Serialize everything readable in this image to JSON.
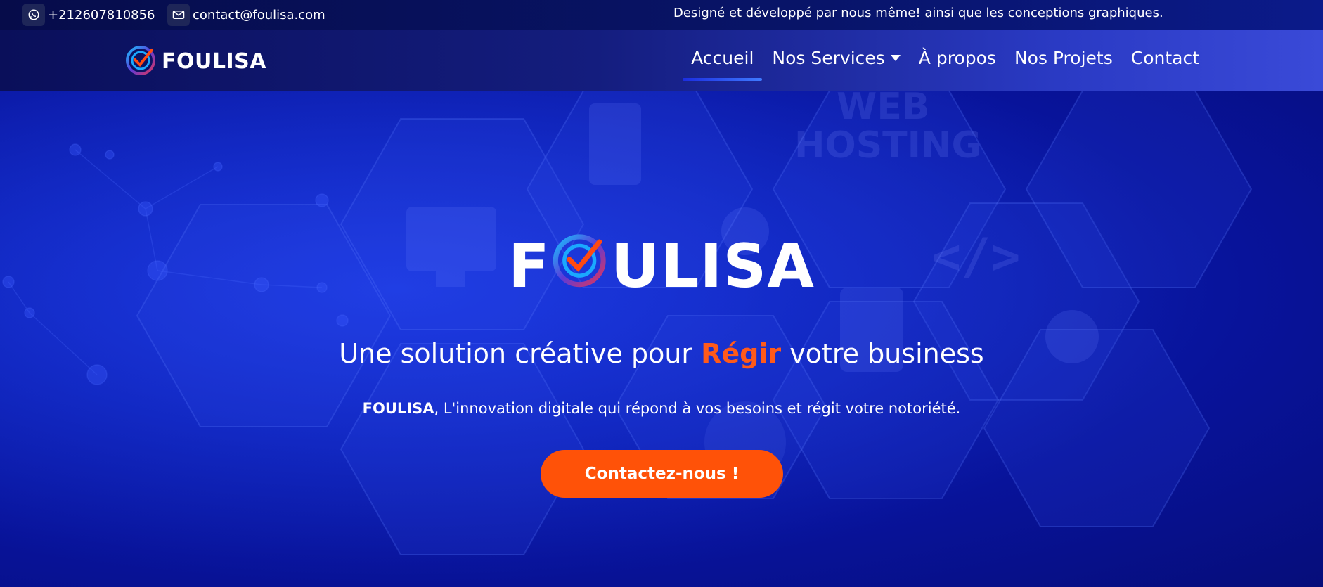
{
  "topbar": {
    "phone": "+212607810856",
    "email": "contact@foulisa.com",
    "tagline": "Designé et développé par nous même! ainsi que les conceptions graphiques."
  },
  "brand": {
    "name": "FOULISA"
  },
  "nav": {
    "items": [
      {
        "label": "Accueil"
      },
      {
        "label": "Nos Services"
      },
      {
        "label": "À propos"
      },
      {
        "label": "Nos Projets"
      },
      {
        "label": "Contact"
      }
    ]
  },
  "hero": {
    "logo_prefix": "F",
    "logo_suffix": "ULISA",
    "headline_pre": "Une solution créative pour ",
    "headline_accent": "Régir",
    "headline_post": " votre business",
    "sub_bold": "FOULISA",
    "sub_rest": ", L'innovation digitale qui répond à vos besoins et régit votre notoriété.",
    "cta_label": "Contactez-nous !"
  },
  "colors": {
    "accent": "#ff5208",
    "hero_blue": "#0d22b8",
    "nav_dark": "#0a0f5a"
  },
  "icons": [
    "whatsapp-icon",
    "mail-icon",
    "logo-check-icon"
  ]
}
